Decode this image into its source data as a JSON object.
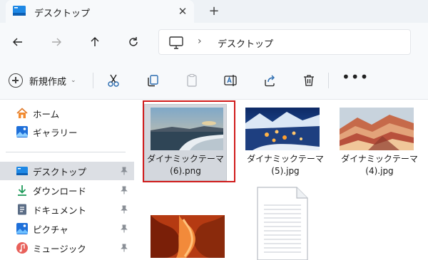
{
  "window": {
    "tab_title": "デスクトップ",
    "tab_close": "✕",
    "new_tab": "+"
  },
  "address_bar": {
    "separator": "›",
    "location": "デスクトップ"
  },
  "toolbar": {
    "new_label": "新規作成",
    "new_caret": "⌄",
    "more_label": "•••"
  },
  "sidebar": {
    "items": [
      {
        "label": "ホーム",
        "icon": "home-icon"
      },
      {
        "label": "ギャラリー",
        "icon": "gallery-icon"
      },
      {
        "label": "デスクトップ",
        "icon": "desktop-folder-icon",
        "selected": true,
        "pinned": true
      },
      {
        "label": "ダウンロード",
        "icon": "download-icon",
        "pinned": true
      },
      {
        "label": "ドキュメント",
        "icon": "document-icon",
        "pinned": true
      },
      {
        "label": "ピクチャ",
        "icon": "pictures-icon",
        "pinned": true
      },
      {
        "label": "ミュージック",
        "icon": "music-icon",
        "pinned": true
      }
    ]
  },
  "files": [
    {
      "line1": "ダイナミックテーマ",
      "line2": "(6).png",
      "selected": true
    },
    {
      "line1": "ダイナミックテーマ",
      "line2": "(5).jpg",
      "selected": false
    },
    {
      "line1": "ダイナミックテーマ",
      "line2": "(4).jpg",
      "selected": false
    },
    {
      "line1": "",
      "line2": "",
      "selected": false
    },
    {
      "line1": "",
      "line2": "",
      "selected": false
    }
  ],
  "colors": {
    "highlight": "#d01b1b",
    "selection": "#d3d7dd",
    "accent": "#1e88e5"
  }
}
